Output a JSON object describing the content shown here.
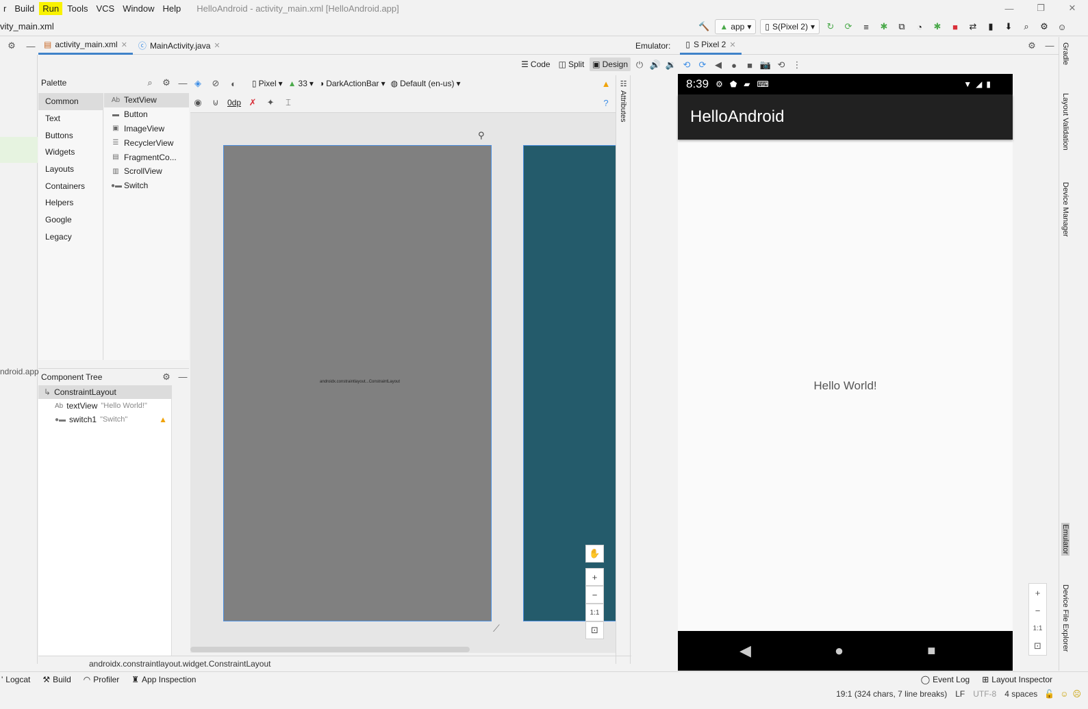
{
  "menu": {
    "items": [
      "r",
      "Build",
      "Run",
      "Tools",
      "VCS",
      "Window",
      "Help"
    ],
    "highlighted_index": 2,
    "window_title": "HelloAndroid - activity_main.xml [HelloAndroid.app]"
  },
  "nav": {
    "breadcrumb": "vity_main.xml",
    "run_config": "app",
    "device": "S(Pixel 2)"
  },
  "editor": {
    "tabs": [
      {
        "label": "activity_main.xml",
        "active": true
      },
      {
        "label": "MainActivity.java",
        "active": false
      }
    ],
    "modes": [
      "Code",
      "Split",
      "Design"
    ],
    "active_mode": "Design"
  },
  "palette": {
    "title": "Palette",
    "categories": [
      "Common",
      "Text",
      "Buttons",
      "Widgets",
      "Layouts",
      "Containers",
      "Helpers",
      "Google",
      "Legacy"
    ],
    "items": [
      {
        "icon": "Ab",
        "label": "TextView"
      },
      {
        "icon": "▬",
        "label": "Button"
      },
      {
        "icon": "▣",
        "label": "ImageView"
      },
      {
        "icon": "☰",
        "label": "RecyclerView"
      },
      {
        "icon": "▤",
        "label": "FragmentCo..."
      },
      {
        "icon": "▥",
        "label": "ScrollView"
      },
      {
        "icon": "●▬",
        "label": "Switch"
      }
    ]
  },
  "design_toolbar": {
    "device": "Pixel",
    "api": "33",
    "theme": "DarkActionBar",
    "locale": "Default (en-us)",
    "margin": "0dp"
  },
  "component_tree": {
    "title": "Component Tree",
    "root": "ConstraintLayout",
    "children": [
      {
        "icon": "Ab",
        "name": "textView",
        "text": "\"Hello World!\"",
        "warning": false
      },
      {
        "icon": "●▬",
        "name": "switch1",
        "text": "\"Switch\"",
        "warning": true
      }
    ]
  },
  "canvas": {
    "preview_text": "androidx.constraintlayout...ConstraintLayout",
    "zoom_ratio": "1:1"
  },
  "attributes_label": "Attributes",
  "status_path": "androidx.constraintlayout.widget.ConstraintLayout",
  "left_cut_text": "ndroid.app",
  "emulator": {
    "label": "Emulator:",
    "tab": "S Pixel 2",
    "time": "8:39",
    "app_title": "HelloAndroid",
    "hello_text": "Hello World!",
    "zoom_ratio": "1:1"
  },
  "right_tools": [
    "Gradle",
    "Layout Validation",
    "Device Manager",
    "Emulator",
    "Device File Explorer"
  ],
  "bottom_tools": [
    "Logcat",
    "Build",
    "Profiler",
    "App Inspection"
  ],
  "bottom_right_tools": [
    "Event Log",
    "Layout Inspector"
  ],
  "status": {
    "position": "19:1 (324 chars, 7 line breaks)",
    "line_sep": "LF",
    "encoding": "UTF-8",
    "indent": "4 spaces"
  },
  "colors": {
    "highlight": "#f9f200",
    "design_surface": "#808080",
    "blueprint": "#245b6b",
    "selection": "#4b8fe0",
    "warning": "#f0a30a",
    "help": "#3d8ee6",
    "stop": "#d9303a",
    "run": "#4caa4c"
  }
}
